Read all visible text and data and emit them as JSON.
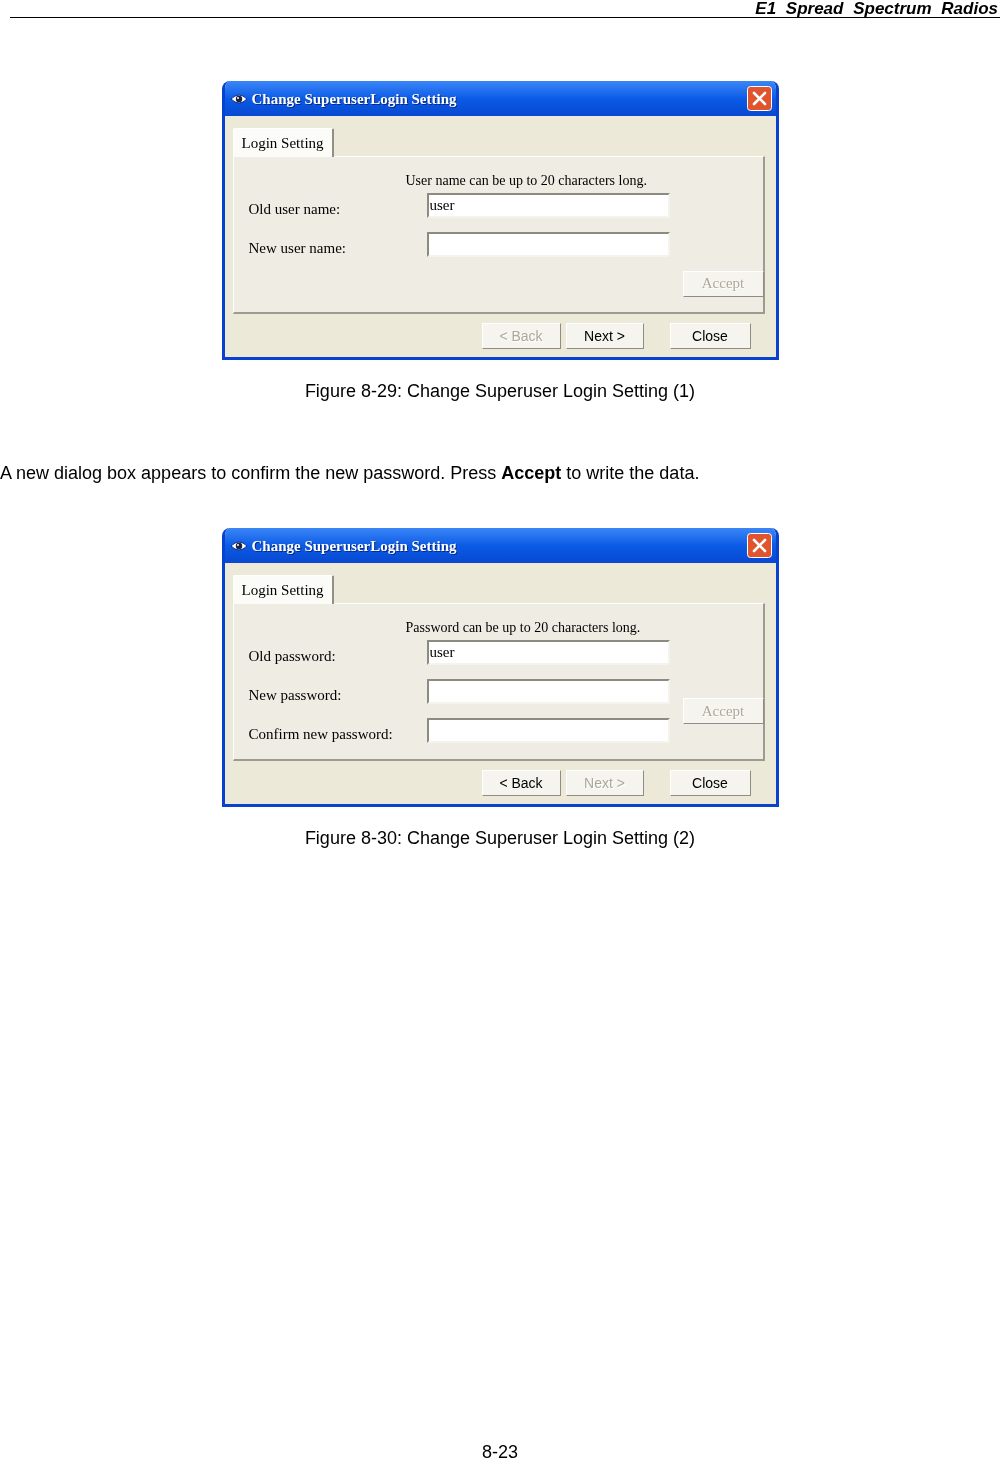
{
  "header": {
    "title": "E1 Spread Spectrum Radios"
  },
  "blocks": [
    {
      "kind": "figure",
      "dialog": {
        "title": "Change SuperuserLogin Setting",
        "tabs": [
          {
            "label": "Login Setting",
            "selected": true
          }
        ],
        "hint": "User name can be up to 20 characters long.",
        "fields": [
          {
            "label": "Old user name:",
            "value": "user"
          },
          {
            "label": "New user name:"
          }
        ],
        "accept_button": {
          "label": "Accept",
          "disabled": true
        },
        "buttons": [
          {
            "label": "< Back",
            "disabled": true
          },
          {
            "label": "Next >",
            "disabled": false
          },
          {
            "label": "Close",
            "disabled": false
          }
        ]
      },
      "caption": "Figure 8-29: Change Superuser Login Setting (1)"
    },
    {
      "kind": "paragraph",
      "text": "A new dialog box appears to confirm the new password. Press **Accept** to write the data."
    },
    {
      "kind": "figure",
      "dialog": {
        "title": "Change SuperuserLogin Setting",
        "tabs": [
          {
            "label": "Login Setting",
            "selected": true
          }
        ],
        "hint": "Password can be up to 20 characters long.",
        "fields": [
          {
            "label": "Old password:",
            "value": "user"
          },
          {
            "label": "New password:"
          },
          {
            "label": "Confirm new password:"
          }
        ],
        "accept_button": {
          "label": "Accept",
          "disabled": true
        },
        "buttons": [
          {
            "label": "< Back",
            "disabled": false
          },
          {
            "label": "Next >",
            "disabled": true
          },
          {
            "label": "Close",
            "disabled": false
          }
        ]
      },
      "caption": "Figure 8-30: Change Superuser Login Setting (2)"
    }
  ],
  "page_number": "8-23"
}
